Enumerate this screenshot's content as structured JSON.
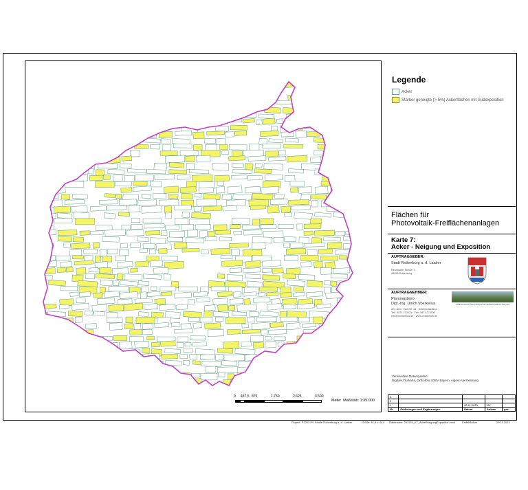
{
  "legend": {
    "title": "Legende",
    "items": [
      {
        "label": "Acker",
        "color": "#ffffff"
      },
      {
        "label": "Stärker geneigte (> 5%) Ackerflächen mit Südexposition",
        "color": "#f4f466"
      }
    ]
  },
  "title_block": {
    "line1": "Flächen für",
    "line2": "Photovoltaik-Freiflächenanlagen",
    "karte": "Karte 7:",
    "subtitle": "Acker - Neigung und Exposition"
  },
  "auftraggeber": {
    "label": "AUFTRAGGEBER:",
    "name": "Stadt Rottenburg a. d. Laaber",
    "street": "Neustadter Straße 1",
    "city": "84056 Rottenburg"
  },
  "auftragnehmer": {
    "label": "AUFTRAGNEHMER:",
    "name": "Planungsbüro",
    "person": "Dipl.-Ing. Ulrich Voerkelius",
    "address": "Wo. Abnr. Mar-Str. 18 · 84034 Landshut",
    "phone": "Tel.: 0871 273031 · Fax: 0871 273032",
    "email": "info@voerkelius.de · www.voerkelius.de",
    "logo_text": "LANDSCHAFTSPLANUNG UND UMWELTARCHITEKTUR"
  },
  "sources": {
    "label": "Verwendete Datenquellen:",
    "text": "Digitale Flurkarte, Orthofoto LDBV Bayern, eigene Vermessung"
  },
  "revisions": {
    "rows": [
      {
        "nr": "3",
        "text": "",
        "date": "",
        "init": "",
        "check": ""
      },
      {
        "nr": "2",
        "text": "",
        "date": "",
        "init": "",
        "check": ""
      },
      {
        "nr": "1",
        "text": "",
        "date": "26.11.2023",
        "init": "UV",
        "check": ""
      }
    ],
    "header": {
      "nr": "Nr.",
      "text": "Änderungen und Ergänzungen",
      "date": "Datum",
      "init": "Anlass",
      "check": "gez."
    }
  },
  "footer": {
    "project": "Projekt: P1203 PV Studie Rottenburg a. d. Laaber",
    "size": "Größe: 81,8 x 44,0",
    "file": "Dateiname: 231129_K7_AckerNeigungExposition.mxd",
    "status_label": "Erstelldatum",
    "date": "29.11.2023"
  },
  "scale": {
    "ticks": [
      "0",
      "437,5",
      "875",
      "1.750",
      "2.625",
      "3.500"
    ],
    "unit": "Meter",
    "ratio": "Maßstab: 1:35.000"
  },
  "colors": {
    "boundary": "#c040c8",
    "parcel_outline": "#5a9a7a",
    "steep_south": "#f4f466"
  }
}
